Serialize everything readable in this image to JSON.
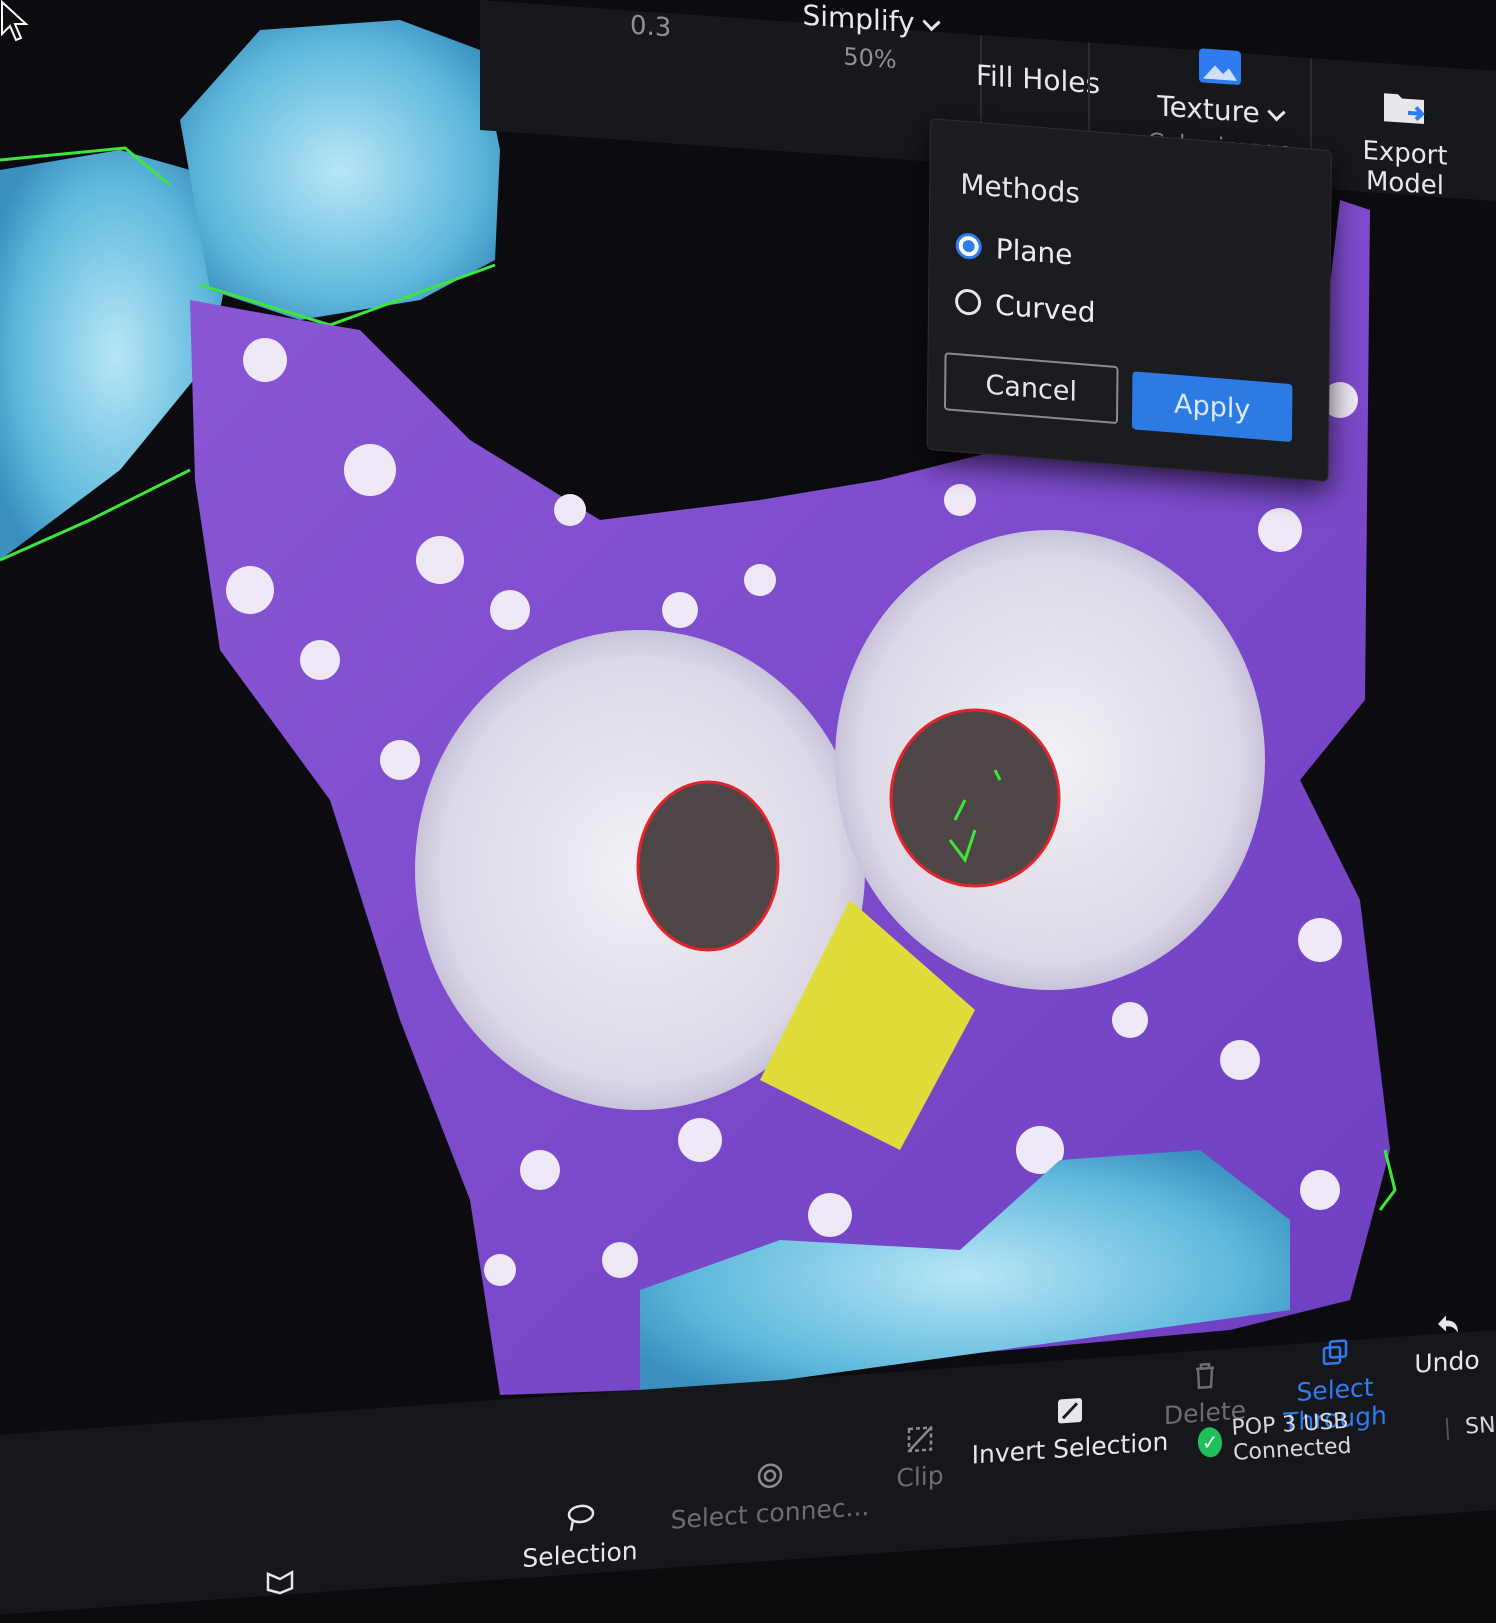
{
  "toolbar": {
    "value_left": "0.3",
    "simplify_label": "Simplify",
    "simplify_value": "50%",
    "fill_holes_label": "Fill Holes",
    "texture_label": "Texture",
    "texture_sub": "Color image",
    "export_label": "Export Model"
  },
  "fill_holes_popup": {
    "title": "Methods",
    "options": [
      {
        "label": "Plane",
        "selected": true
      },
      {
        "label": "Curved",
        "selected": false
      }
    ],
    "cancel_label": "Cancel",
    "apply_label": "Apply"
  },
  "bottom_toolbar": {
    "items": [
      {
        "label": "Selection",
        "icon": "lasso-icon",
        "state": "enabled"
      },
      {
        "label": "Select connec...",
        "icon": "connect-icon",
        "state": "disabled"
      },
      {
        "label": "Clip",
        "icon": "clip-icon",
        "state": "disabled"
      },
      {
        "label": "Invert Selection",
        "icon": "invert-icon",
        "state": "enabled"
      },
      {
        "label": "Delete",
        "icon": "trash-icon",
        "state": "disabled"
      },
      {
        "label": "Select Through",
        "icon": "layers-icon",
        "state": "active"
      },
      {
        "label": "Undo",
        "icon": "undo-icon",
        "state": "enabled"
      }
    ]
  },
  "status": {
    "device": "POP 3 USB Connected",
    "sn_prefix": "SN"
  },
  "colors": {
    "accent_blue": "#2c7be5",
    "model_purple": "#7a4cc9",
    "selection_green": "#3fe63a",
    "hole_outline_red": "#e3242b",
    "status_ok": "#1fbf5a"
  }
}
